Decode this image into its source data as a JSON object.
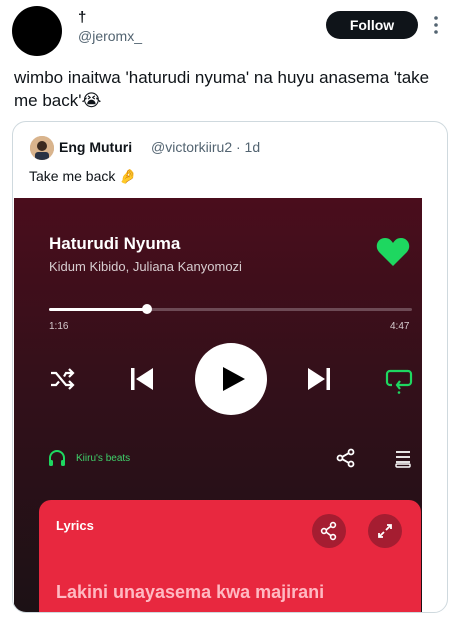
{
  "post": {
    "display_name": "†",
    "handle": "@jeromx_",
    "follow_label": "Follow",
    "text": "wimbo inaitwa 'haturudi nyuma' na huyu anasema 'take me back'😭"
  },
  "quote": {
    "author_name": "Eng Muturi",
    "author_handle": "@victorkiiru2 · 1d",
    "text": "Take me back 🤌"
  },
  "player": {
    "song_title": "Haturudi Nyuma",
    "artists": "Kidum Kibido, Juliana Kanyomozi",
    "time_elapsed": "1:16",
    "time_total": "4:47",
    "progress_fraction": 0.27,
    "device_label": "Kiiru's beats",
    "lyrics_label": "Lyrics",
    "lyric_line": "Lakini unayasema kwa majirani",
    "accent_green": "#1ed760",
    "lyrics_bg": "#e8283f",
    "icons": [
      "heart-icon",
      "shuffle-icon",
      "previous-icon",
      "play-icon",
      "next-icon",
      "repeat-icon",
      "headphones-icon",
      "share-icon",
      "queue-icon",
      "expand-icon"
    ]
  }
}
